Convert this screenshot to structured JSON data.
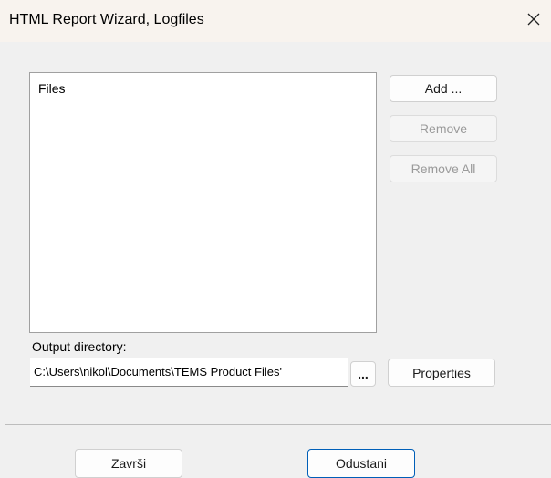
{
  "window": {
    "title": "HTML Report Wizard, Logfiles",
    "close_icon": "close-icon"
  },
  "files_list": {
    "column_header": "Files",
    "items": []
  },
  "buttons": {
    "add": "Add ...",
    "remove": "Remove",
    "remove_all": "Remove All",
    "browse": "...",
    "properties": "Properties",
    "finish": "Završi",
    "cancel": "Odustani"
  },
  "output": {
    "label": "Output directory:",
    "value": "C:\\Users\\nikol\\Documents\\TEMS Product Files'"
  },
  "colors": {
    "titlebar_bg": "#f8f3ee",
    "dialog_bg": "#f0f0f0",
    "accent": "#005fb8",
    "disabled_text": "#9a9a9a"
  }
}
